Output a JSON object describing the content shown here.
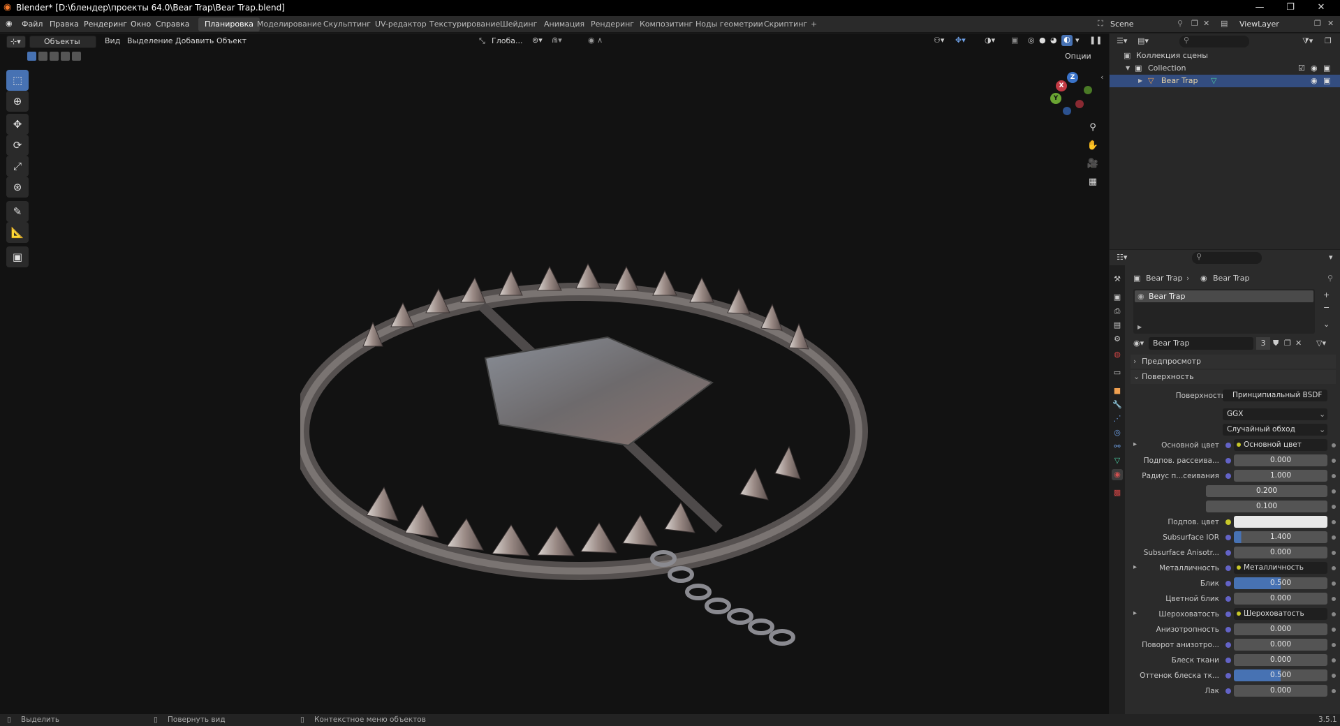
{
  "window": {
    "title": "Blender* [D:\\блендер\\проекты 64.0\\Bear Trap\\Bear Trap.blend]",
    "controls": [
      "—",
      "❐",
      "✕"
    ]
  },
  "menu": [
    "Файл",
    "Правка",
    "Рендеринг",
    "Окно",
    "Справка"
  ],
  "workspaces": [
    "Планировка",
    "Моделирование",
    "Скульптинг",
    "UV-редактор",
    "Текстурирование",
    "Шейдинг",
    "Анимация",
    "Рендеринг",
    "Композитинг",
    "Ноды геометрии",
    "Скриптинг",
    "+"
  ],
  "active_workspace": "Планировка",
  "scene": "Scene",
  "view_layer": "ViewLayer",
  "viewport": {
    "mode": "Объекты",
    "menus": [
      "Вид",
      "Выделение",
      "Добавить",
      "Объект"
    ],
    "orientation": "Глоба...",
    "options": "Опции",
    "gizmo_axes": [
      "Z",
      "Y",
      "X"
    ]
  },
  "outliner": {
    "root": "Коллекция сцены",
    "collection": "Collection",
    "object": "Bear Trap"
  },
  "properties": {
    "breadcrumb": [
      "Bear Trap",
      "Bear Trap"
    ],
    "slot": "Bear Trap",
    "material": "Bear Trap",
    "users": "3",
    "panels": {
      "preview": "Предпросмотр",
      "surface": "Поверхность"
    },
    "surface_label": "Поверхность",
    "surface_value": "Принципиальный BSDF",
    "distribution": "GGX",
    "subsurface_method": "Случайный обход",
    "rows": [
      {
        "label": "Основной цвет",
        "value": "Основной цвет",
        "kind": "link",
        "expand": true
      },
      {
        "label": "Подпов. рассеива...",
        "value": "0.000",
        "kind": "num"
      },
      {
        "label": "Радиус п...сеивания",
        "value": "1.000",
        "kind": "num"
      },
      {
        "label": "",
        "value": "0.200",
        "kind": "num"
      },
      {
        "label": "",
        "value": "0.100",
        "kind": "num"
      },
      {
        "label": "Подпов. цвет",
        "value": "",
        "kind": "color"
      },
      {
        "label": "Subsurface IOR",
        "value": "1.400",
        "kind": "fill",
        "fill": 0.08
      },
      {
        "label": "Subsurface Anisotr...",
        "value": "0.000",
        "kind": "num"
      },
      {
        "label": "Металличность",
        "value": "Металличность",
        "kind": "link",
        "expand": true
      },
      {
        "label": "Блик",
        "value": "0.500",
        "kind": "fill",
        "fill": 0.5
      },
      {
        "label": "Цветной блик",
        "value": "0.000",
        "kind": "num"
      },
      {
        "label": "Шероховатость",
        "value": "Шероховатость",
        "kind": "link",
        "expand": true
      },
      {
        "label": "Анизотропность",
        "value": "0.000",
        "kind": "num"
      },
      {
        "label": "Поворот анизотро...",
        "value": "0.000",
        "kind": "num"
      },
      {
        "label": "Блеск ткани",
        "value": "0.000",
        "kind": "num"
      },
      {
        "label": "Оттенок блеска тк...",
        "value": "0.500",
        "kind": "fill",
        "fill": 0.5
      },
      {
        "label": "Лак",
        "value": "0.000",
        "kind": "num"
      }
    ]
  },
  "status": {
    "select": "Выделить",
    "rotate": "Повернуть вид",
    "context": "Контекстное меню объектов",
    "version": "3.5.1"
  }
}
